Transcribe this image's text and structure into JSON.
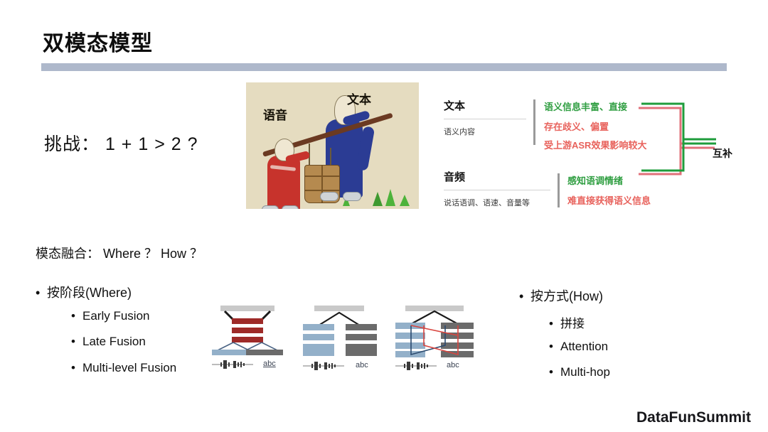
{
  "slide": {
    "title": "双模态模型",
    "challenge": "挑战： 1 + 1 > 2 ?",
    "fusion_heading": "模态融合： Where ？ How ？",
    "footer_logo": "DataFunSummit",
    "accent_rule_color": "#aeb8cb",
    "positive_color": "#2f9e41",
    "negative_color": "#e8625c"
  },
  "illustration": {
    "speech_label": "语音",
    "text_label": "文本",
    "background_color": "#e5dcc0"
  },
  "modalities": [
    {
      "name": "文本",
      "subtitle": "语义内容",
      "attributes": [
        {
          "text": "语义信息丰富、直接",
          "polarity": "positive"
        },
        {
          "text": "存在歧义、偏置",
          "polarity": "negative"
        },
        {
          "text": "受上游ASR效果影响较大",
          "polarity": "negative"
        }
      ]
    },
    {
      "name": "音频",
      "subtitle": "说话语调、语速、音量等",
      "attributes": [
        {
          "text": "感知语调情绪",
          "polarity": "positive"
        },
        {
          "text": "难直接获得语义信息",
          "polarity": "negative"
        }
      ]
    }
  ],
  "bracket": {
    "label": "互补",
    "green_color": "#1f9c3c",
    "red_color": "#e0707a"
  },
  "fusion": {
    "where": {
      "heading": "按阶段(Where)",
      "items": [
        "Early Fusion",
        "Late Fusion",
        "Multi-level Fusion"
      ]
    },
    "how": {
      "heading": "按方式(How)",
      "items": [
        "拼接",
        "Attention",
        "Multi-hop"
      ]
    }
  },
  "diagrams": [
    {
      "name": "early-fusion",
      "audio_caption": "",
      "text_caption": "abc"
    },
    {
      "name": "late-fusion",
      "audio_caption": "",
      "text_caption": "abc"
    },
    {
      "name": "multi-level-fusion",
      "audio_caption": "",
      "text_caption": "abc"
    }
  ]
}
